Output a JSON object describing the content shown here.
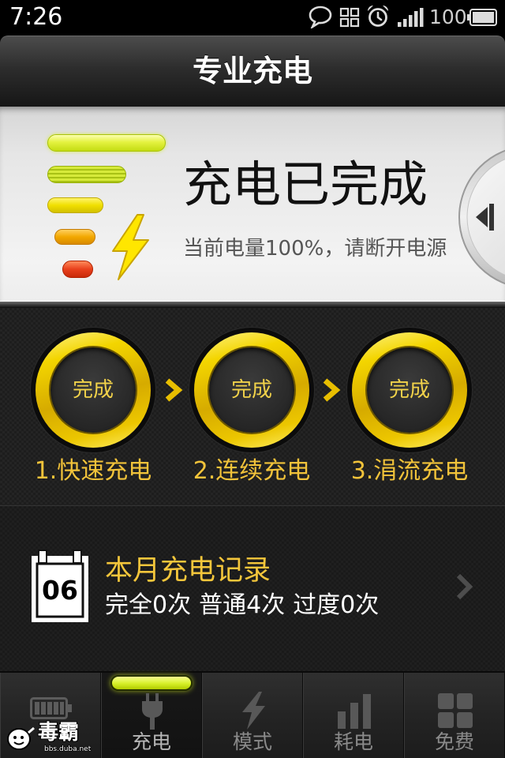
{
  "status_bar": {
    "time": "7:26",
    "battery_text": "100",
    "icons": [
      "chat-icon",
      "grid-icon",
      "alarm-icon",
      "signal-icon",
      "battery-icon"
    ]
  },
  "header": {
    "title": "专业充电"
  },
  "charge_status": {
    "headline": "充电已完成",
    "detail": "当前电量100%，请断开电源",
    "level_icon": "battery-level-icon",
    "toggle_icon": "collapse-arrow-icon"
  },
  "stages": [
    {
      "state": "完成",
      "label": "1.快速充电"
    },
    {
      "state": "完成",
      "label": "2.连续充电"
    },
    {
      "state": "完成",
      "label": "3.涓流充电"
    }
  ],
  "monthly_record": {
    "icon": "calendar-icon",
    "calendar_day": "06",
    "title": "本月充电记录",
    "counts": [
      "完全0次",
      "普通4次",
      "过度0次"
    ]
  },
  "tabs": [
    {
      "icon": "battery-icon"
    },
    {
      "icon": "plug-icon",
      "label": "充电",
      "active": true
    },
    {
      "icon": "lightning-icon",
      "label": "模式"
    },
    {
      "icon": "bar-chart-icon",
      "label": "耗电"
    },
    {
      "icon": "grid-icon",
      "label": "免费"
    }
  ],
  "watermark": {
    "brand": "毒霸",
    "url": "bbs.duba.net"
  },
  "colors": {
    "accent": "#f2c33a",
    "ring": "#f3d500",
    "active_tab_glow": "#d6f020",
    "icon_gray": "#5a5a5a"
  }
}
